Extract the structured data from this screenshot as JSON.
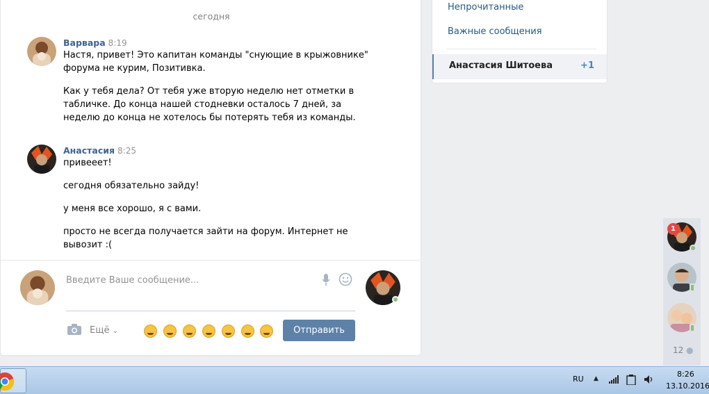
{
  "chat": {
    "date_separator": "сегодня",
    "messages": [
      {
        "author": "Варвара",
        "time": "8:19",
        "paragraphs": [
          [
            "Настя, привет! Это капитан команды \"снующие в крыжовнике\"",
            "форума не курим, Позитивка."
          ],
          [
            "Как у тебя дела? От тебя уже вторую неделю нет отметки в",
            "табличке. До конца нашей стодневки осталось 7 дней, за",
            "неделю до конца не хотелось бы потерять тебя из команды."
          ]
        ]
      },
      {
        "author": "Анастасия",
        "time": "8:25",
        "paragraphs": [
          [
            "привееет!"
          ],
          [
            "сегодня обязательно зайду!"
          ],
          [
            "у меня все хорошо, я с вами."
          ],
          [
            "просто не всегда получается зайти на форум. Интернет не",
            "вывозит :("
          ]
        ]
      }
    ]
  },
  "composer": {
    "placeholder": "Введите Ваше сообщение...",
    "more_label": "Ещё",
    "send_label": "Отправить"
  },
  "menu": {
    "items": [
      "Непрочитанные",
      "Важные сообщения"
    ],
    "active_conversation": "Анастасия Шитоева",
    "active_count": "+1"
  },
  "contacts_strip": {
    "badge": "1",
    "count": "12"
  },
  "taskbar": {
    "lang": "RU",
    "time": "8:26",
    "date": "13.10.2016"
  },
  "colors": {
    "link": "#2a5885",
    "author": "#42648b",
    "button": "#5e81a8",
    "online": "#8ac176",
    "badge": "#e64646"
  }
}
